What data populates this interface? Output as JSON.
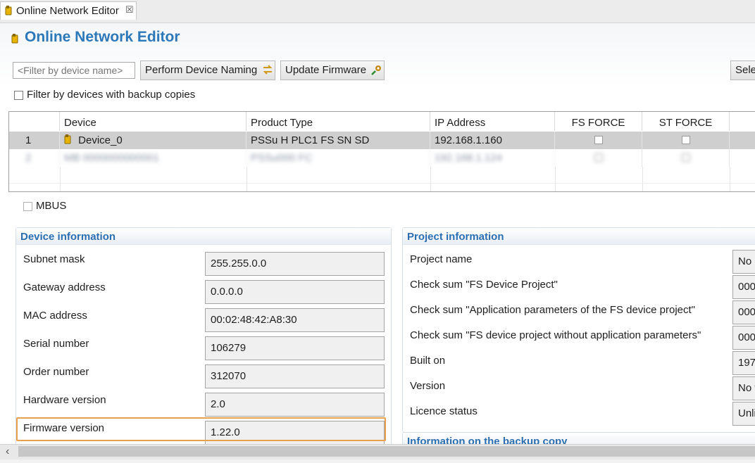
{
  "window": {
    "tab_label": "Online Network Editor",
    "tab_close_glyph": "☒",
    "title": "Online Network Editor"
  },
  "toolbar": {
    "filter_placeholder": "<Filter by device name>",
    "perform_naming_label": "Perform Device Naming",
    "update_firmware_label": "Update Firmware",
    "select_label": "Sele"
  },
  "filter_backup_label": "Filter by devices with backup copies",
  "table": {
    "columns": [
      "",
      "Device",
      "Product Type",
      "IP Address",
      "FS FORCE",
      "ST FORCE"
    ],
    "rows": [
      {
        "index": "1",
        "device": "Device_0",
        "product_type": "PSSu H PLC1 FS SN SD",
        "ip": "192.168.1.160",
        "fs_force": false,
        "st_force": false,
        "selected": true
      },
      {
        "index": "2",
        "device": "MB 0000000000001",
        "product_type": "PSSu000 FC",
        "ip": "192.168.1.124",
        "fs_force": false,
        "st_force": false,
        "selected": false,
        "blurred": true
      }
    ]
  },
  "mbus_label": "MBUS",
  "device_info": {
    "heading": "Device information",
    "fields": [
      {
        "label": "Subnet mask",
        "value": "255.255.0.0"
      },
      {
        "label": "Gateway address",
        "value": "0.0.0.0"
      },
      {
        "label": "MAC address",
        "value": "00:02:48:42:A8:30"
      },
      {
        "label": "Serial number",
        "value": "106279"
      },
      {
        "label": "Order number",
        "value": "312070"
      },
      {
        "label": "Hardware version",
        "value": "2.0"
      },
      {
        "label": "Firmware version",
        "value": "1.22.0"
      }
    ]
  },
  "project_info": {
    "heading": "Project information",
    "fields": [
      {
        "label": "Project name",
        "value": "No"
      },
      {
        "label": "Check sum \"FS Device Project\"",
        "value": "000"
      },
      {
        "label": "Check sum \"Application parameters of the FS device project\"",
        "value": "000"
      },
      {
        "label": "Check sum \"FS device project without application parameters\"",
        "value": "000"
      },
      {
        "label": "Built on",
        "value": "197"
      },
      {
        "label": "Version",
        "value": "No v"
      },
      {
        "label": "Licence status",
        "value": "Unli"
      }
    ]
  },
  "backup_info": {
    "heading": "Information on the backup copy"
  },
  "colors": {
    "title_blue": "#2c78b8",
    "panel_heading_blue": "#2c6fb0",
    "highlight_orange": "#e7a04b",
    "selected_row": "#cfcfcf",
    "device_icon": "#e8b400"
  },
  "icons": [
    "editor-tab-icon",
    "device-icon",
    "naming-arrows-icon",
    "firmware-update-icon",
    "scroll-left-icon"
  ]
}
